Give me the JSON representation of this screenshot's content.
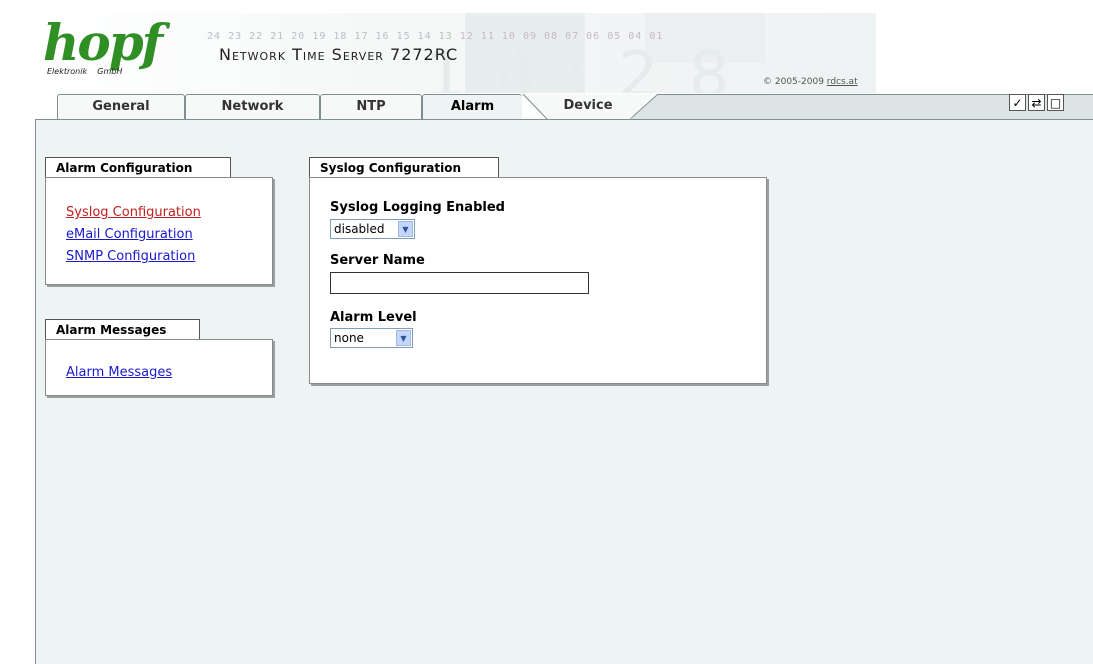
{
  "header": {
    "brand": "hopf",
    "brand_sub_left": "Elektronik",
    "brand_sub_right": "GmbH",
    "digits": [
      "24",
      "23",
      "22",
      "21",
      "20",
      "19",
      "18",
      "17",
      "16",
      "15",
      "14",
      "13",
      "12",
      "11",
      "10",
      "09",
      "08",
      "07",
      "06",
      "05",
      "04",
      "01"
    ],
    "product_title": "Network Time Server 7272RC",
    "copyright_prefix": "© 2005-2009",
    "copyright_link": "rdcs.at",
    "colors": {
      "logo": "#2f8f24",
      "digits": "#b9bfc4"
    }
  },
  "tabs": [
    {
      "label": "General",
      "active": false
    },
    {
      "label": "Network",
      "active": false
    },
    {
      "label": "NTP",
      "active": false
    },
    {
      "label": "Alarm",
      "active": true
    },
    {
      "label": "Device",
      "active": false
    }
  ],
  "toolbar": [
    {
      "icon": "checkmark-icon",
      "glyph": "✓"
    },
    {
      "icon": "swap-arrows-icon",
      "glyph": "⇄"
    },
    {
      "icon": "page-icon",
      "glyph": "□"
    }
  ],
  "alarm_config": {
    "title": "Alarm Configuration",
    "links": [
      {
        "label": "Syslog Configuration",
        "visited": true
      },
      {
        "label": "eMail Configuration",
        "visited": false
      },
      {
        "label": "SNMP Configuration",
        "visited": false
      }
    ]
  },
  "alarm_messages": {
    "title": "Alarm Messages",
    "link": "Alarm Messages"
  },
  "syslog": {
    "title": "Syslog Configuration",
    "logging_label": "Syslog Logging Enabled",
    "logging_value": "disabled",
    "server_label": "Server Name",
    "server_value": "",
    "level_label": "Alarm Level",
    "level_value": "none"
  }
}
